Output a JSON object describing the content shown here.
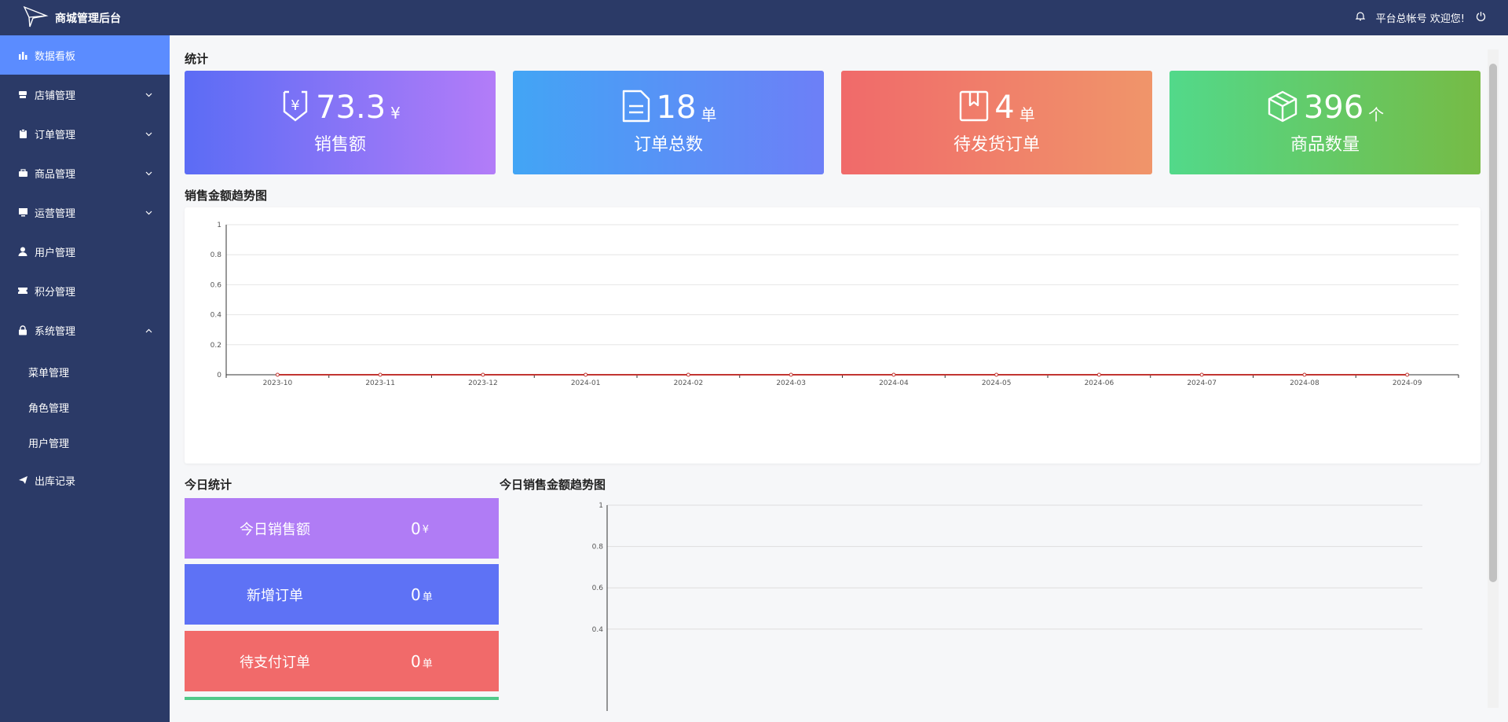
{
  "header": {
    "app_title": "商城管理后台",
    "account_text": "平台总帐号 欢迎您!"
  },
  "sidebar": {
    "items": [
      {
        "label": "数据看板",
        "icon": "bar-chart-icon",
        "active": true
      },
      {
        "label": "店铺管理",
        "icon": "shop-icon",
        "expandable": true
      },
      {
        "label": "订单管理",
        "icon": "clipboard-icon",
        "expandable": true
      },
      {
        "label": "商品管理",
        "icon": "box-icon",
        "expandable": true
      },
      {
        "label": "运营管理",
        "icon": "monitor-icon",
        "expandable": true
      },
      {
        "label": "用户管理",
        "icon": "user-icon"
      },
      {
        "label": "积分管理",
        "icon": "ticket-icon"
      },
      {
        "label": "系统管理",
        "icon": "lock-icon",
        "expanded": true
      }
    ],
    "sub_items": [
      "菜单管理",
      "角色管理",
      "用户管理"
    ],
    "last_item": {
      "label": "出库记录",
      "icon": "send-icon"
    }
  },
  "stats": {
    "title": "统计",
    "cards": [
      {
        "value": "73.3",
        "unit": "¥",
        "label": "销售额",
        "icon": "money-tag-icon",
        "gradient": [
          "#5b6cf5",
          "#b37cf8"
        ]
      },
      {
        "value": "18",
        "unit": "单",
        "label": "订单总数",
        "icon": "document-icon",
        "gradient": [
          "#42a5f5",
          "#6d7ff7"
        ]
      },
      {
        "value": "4",
        "unit": "单",
        "label": "待发货订单",
        "icon": "package-icon",
        "gradient": [
          "#f06a6a",
          "#f0956a"
        ]
      },
      {
        "value": "396",
        "unit": "个",
        "label": "商品数量",
        "icon": "cube-icon",
        "gradient": [
          "#52d98a",
          "#76bb45"
        ]
      }
    ]
  },
  "trend": {
    "title": "销售金额趋势图"
  },
  "today": {
    "title": "今日统计",
    "cards": [
      {
        "label": "今日销售额",
        "value": "0",
        "unit": "¥",
        "color": "#b07cf5"
      },
      {
        "label": "新增订单",
        "value": "0",
        "unit": "单",
        "color": "#5e72f5"
      },
      {
        "label": "待支付订单",
        "value": "0",
        "unit": "单",
        "color": "#f16a6a"
      }
    ]
  },
  "today_trend": {
    "title": "今日销售金额趋势图"
  },
  "chart_data": [
    {
      "type": "line",
      "x": [
        "2023-10",
        "2023-11",
        "2023-12",
        "2024-01",
        "2024-02",
        "2024-03",
        "2024-04",
        "2024-05",
        "2024-06",
        "2024-07",
        "2024-08",
        "2024-09"
      ],
      "series": [
        {
          "values": [
            0,
            0,
            0,
            0,
            0,
            0,
            0,
            0,
            0,
            0,
            0,
            0
          ],
          "color": "#c23531"
        }
      ],
      "yticks": [
        "0",
        "0.2",
        "0.4",
        "0.6",
        "0.8",
        "1"
      ],
      "ylim": [
        0,
        1
      ],
      "grid": true
    },
    {
      "type": "line",
      "yticks_visible": [
        "0.4",
        "0.6",
        "0.8",
        "1"
      ],
      "ylim": [
        0,
        1
      ],
      "grid": true
    }
  ]
}
